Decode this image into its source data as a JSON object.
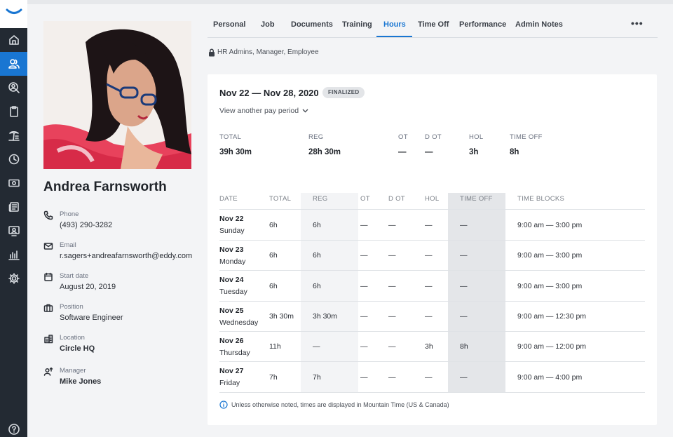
{
  "nav": {
    "items": [
      {
        "icon": "home-icon"
      },
      {
        "icon": "people-icon",
        "active": true
      },
      {
        "icon": "user-search-icon"
      },
      {
        "icon": "clipboard-icon"
      },
      {
        "icon": "beach-icon"
      },
      {
        "icon": "clock-icon"
      },
      {
        "icon": "money-icon"
      },
      {
        "icon": "news-icon"
      },
      {
        "icon": "training-icon"
      },
      {
        "icon": "reports-icon"
      },
      {
        "icon": "settings-icon"
      }
    ],
    "help_icon": "help-icon"
  },
  "profile": {
    "name": "Andrea Farnsworth",
    "phone_label": "Phone",
    "phone": "(493) 290-3282",
    "email_label": "Email",
    "email": "r.sagers+andreafarnsworth@eddy.com",
    "start_label": "Start date",
    "start": "August 20, 2019",
    "position_label": "Position",
    "position": "Software Engineer",
    "location_label": "Location",
    "location": "Circle HQ",
    "manager_label": "Manager",
    "manager": "Mike Jones"
  },
  "tabs": [
    "Personal",
    "Job",
    "Documents",
    "Training",
    "Hours",
    "Time Off",
    "Performance",
    "Admin Notes"
  ],
  "active_tab": "Hours",
  "more_label": "•••",
  "access": "HR Admins, Manager, Employee",
  "period": {
    "title": "Nov 22 — Nov 28, 2020",
    "badge": "FINALIZED",
    "other": "View another pay period"
  },
  "summary": [
    {
      "label": "TOTAL",
      "value": "39h 30m"
    },
    {
      "label": "REG",
      "value": "28h 30m"
    },
    {
      "label": "OT",
      "value": "—"
    },
    {
      "label": "D OT",
      "value": "—"
    },
    {
      "label": "HOL",
      "value": "3h"
    },
    {
      "label": "TIME OFF",
      "value": "8h"
    }
  ],
  "table": {
    "headers": [
      "DATE",
      "TOTAL",
      "REG",
      "OT",
      "D OT",
      "HOL",
      "TIME OFF",
      "TIME BLOCKS"
    ],
    "rows": [
      {
        "date": "Nov 22",
        "day": "Sunday",
        "total": "6h",
        "reg": "6h",
        "ot": "—",
        "dot": "—",
        "hol": "—",
        "off": "—",
        "blocks": "9:00 am — 3:00 pm"
      },
      {
        "date": "Nov 23",
        "day": "Monday",
        "total": "6h",
        "reg": "6h",
        "ot": "—",
        "dot": "—",
        "hol": "—",
        "off": "—",
        "blocks": "9:00 am — 3:00 pm"
      },
      {
        "date": "Nov 24",
        "day": "Tuesday",
        "total": "6h",
        "reg": "6h",
        "ot": "—",
        "dot": "—",
        "hol": "—",
        "off": "—",
        "blocks": "9:00 am — 3:00 pm"
      },
      {
        "date": "Nov 25",
        "day": "Wednesday",
        "total": "3h 30m",
        "reg": "3h 30m",
        "ot": "—",
        "dot": "—",
        "hol": "—",
        "off": "—",
        "blocks": "9:00 am — 12:30 pm"
      },
      {
        "date": "Nov 26",
        "day": "Thursday",
        "total": "11h",
        "reg": "—",
        "ot": "—",
        "dot": "—",
        "hol": "3h",
        "off": "8h",
        "blocks": "9:00 am — 12:00 pm"
      },
      {
        "date": "Nov 27",
        "day": "Friday",
        "total": "7h",
        "reg": "7h",
        "ot": "—",
        "dot": "—",
        "hol": "—",
        "off": "—",
        "blocks": "9:00 am — 4:00 pm"
      }
    ]
  },
  "footnote": "Unless otherwise noted, times are displayed in Mountain Time (US & Canada)",
  "colors": {
    "accent": "#1976d2",
    "rail": "#232a33",
    "time_off_column": "#e4e6e9"
  }
}
